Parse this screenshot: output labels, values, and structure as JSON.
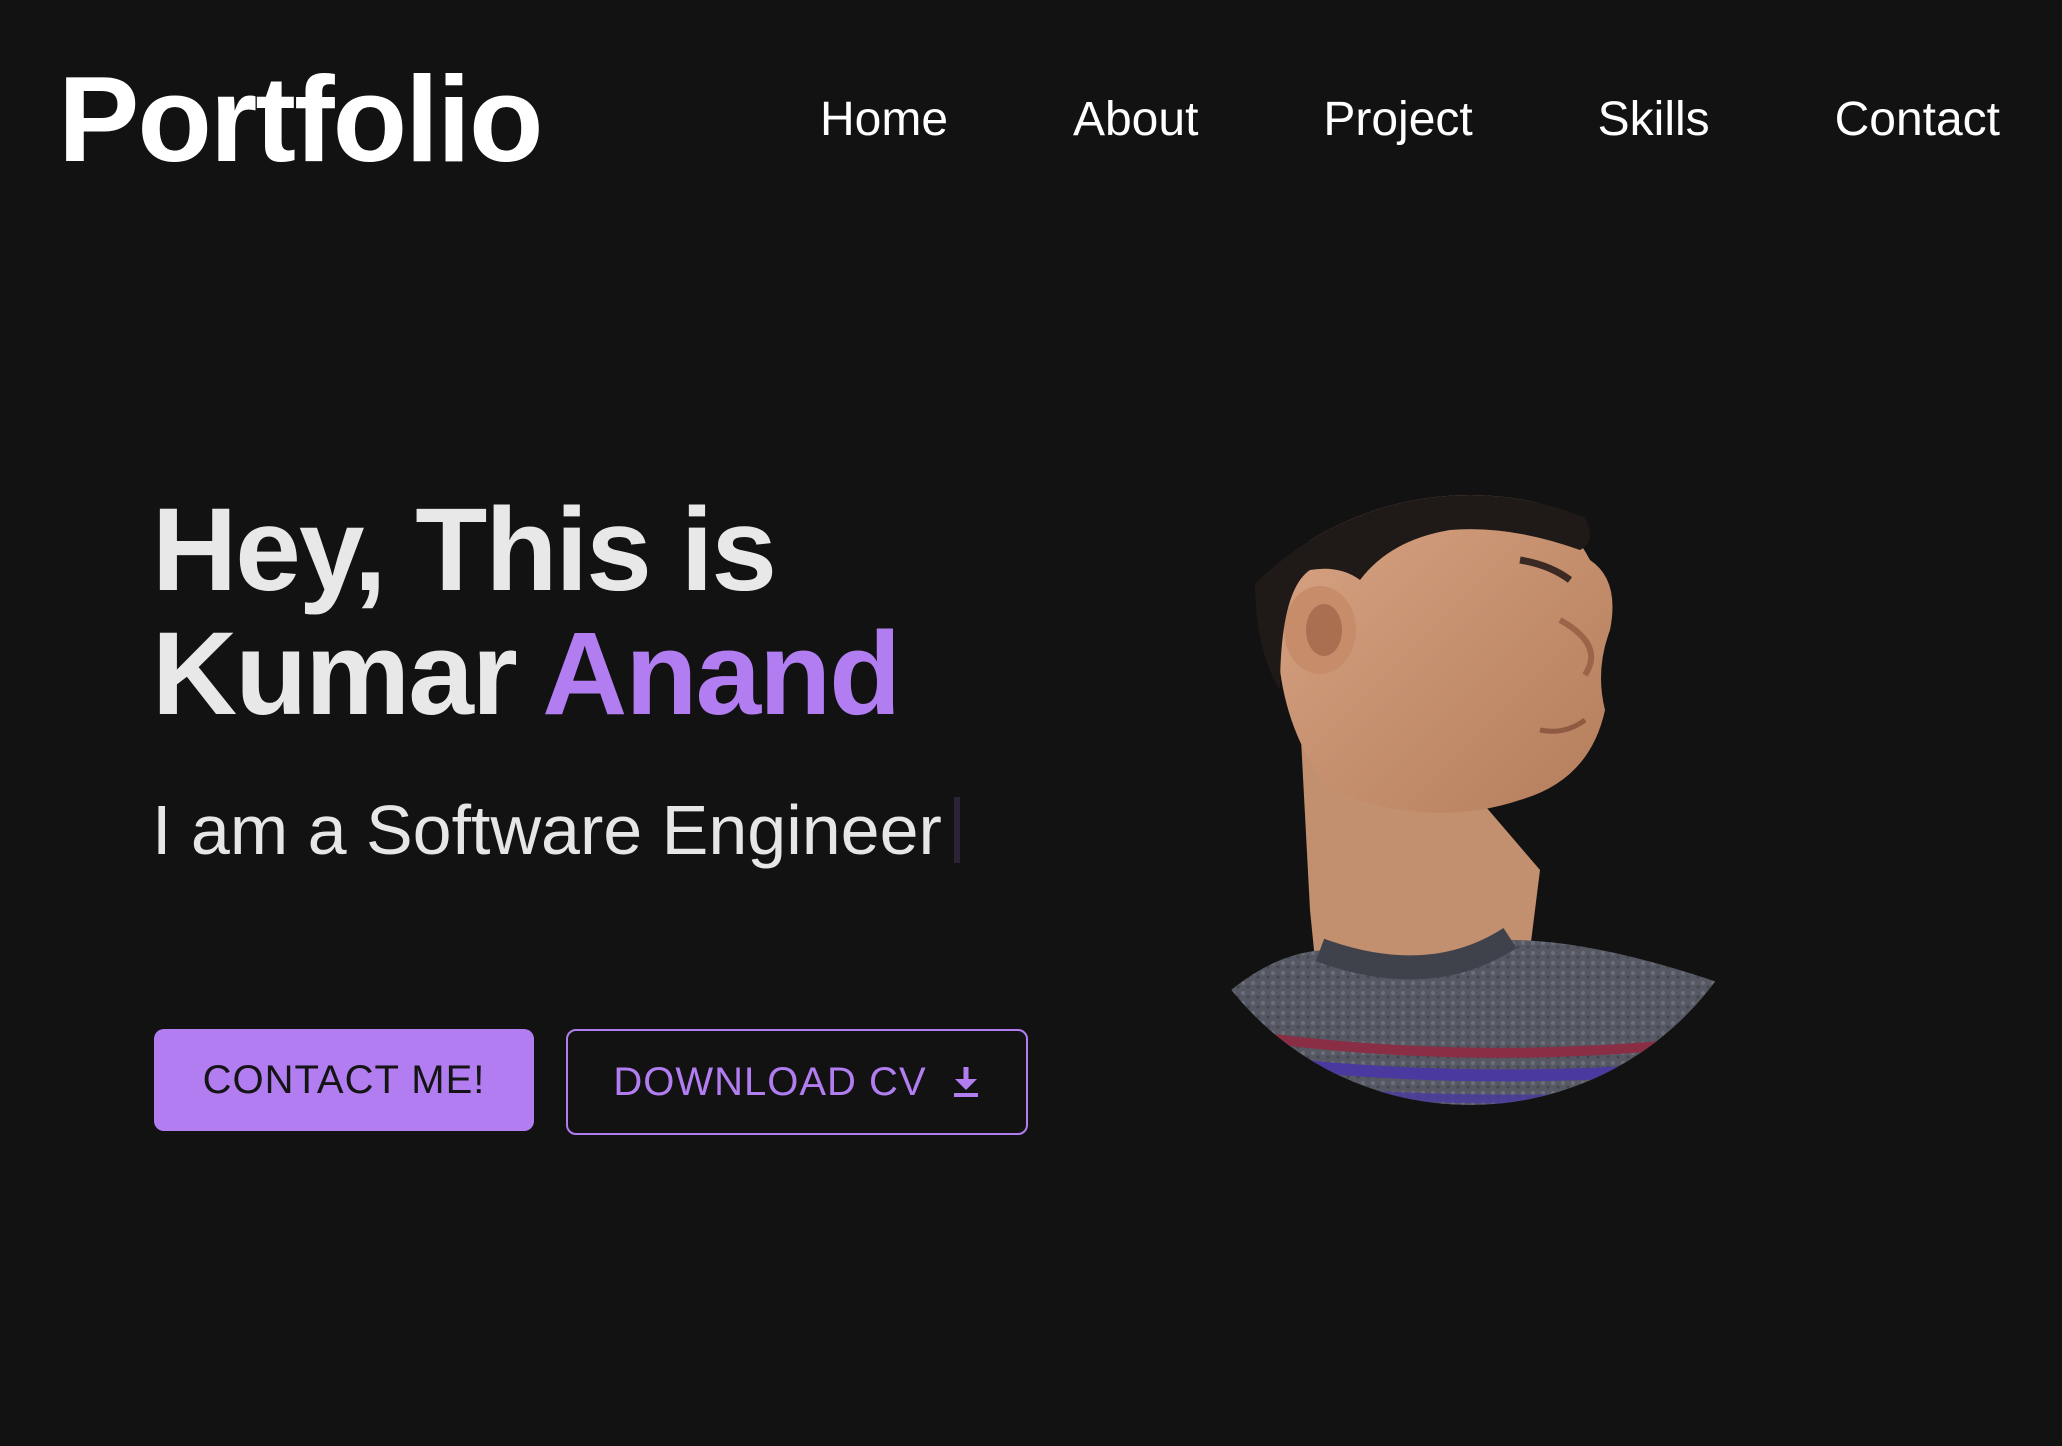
{
  "header": {
    "logo": "Portfolio",
    "nav": [
      "Home",
      "About",
      "Project",
      "Skills",
      "Contact"
    ]
  },
  "hero": {
    "greeting": "Hey, This is",
    "first_name": "Kumar",
    "last_name": "Anand",
    "typed_text": "I am a Software Engineer",
    "contact_button": "CONTACT ME!",
    "download_button": "DOWNLOAD CV",
    "download_icon": "download-icon"
  },
  "colors": {
    "background": "#121212",
    "accent": "#b17df0",
    "text": "#ffffff"
  }
}
